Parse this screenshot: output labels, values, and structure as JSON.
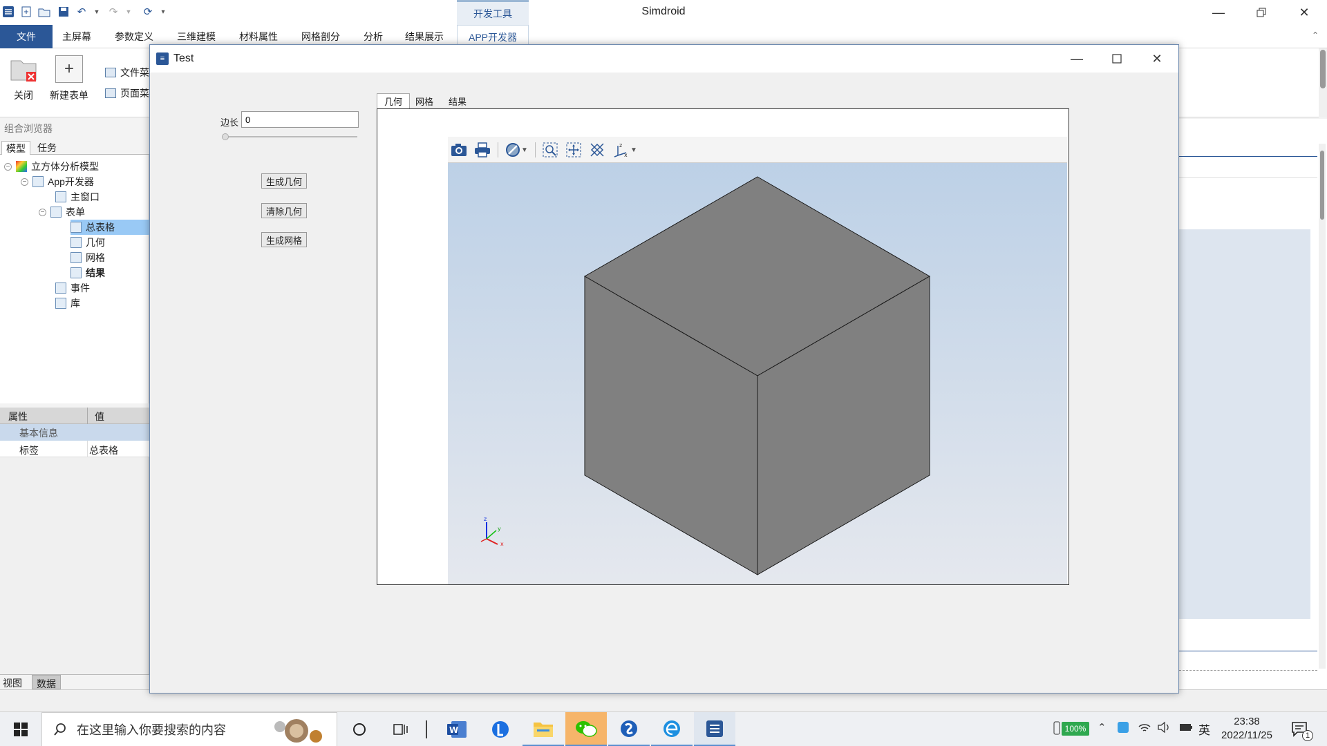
{
  "window": {
    "title": "Simdroid",
    "devtools_tab": "开发工具"
  },
  "ribbon": {
    "file_tab": "文件",
    "tabs": [
      "主屏幕",
      "参数定义",
      "三维建模",
      "材料属性",
      "网格剖分",
      "分析",
      "结果展示",
      "APP开发器"
    ],
    "close_label": "关闭",
    "new_form_label": "新建表单",
    "file_menu_label": "文件菜",
    "page_menu_label": "页面菜"
  },
  "browser": {
    "title": "组合浏览器",
    "tabs": [
      "模型",
      "任务"
    ],
    "tree": {
      "root": "立方体分析模型",
      "app_dev": "App开发器",
      "main_window": "主窗口",
      "forms": "表单",
      "form_items": [
        "总表格",
        "几何",
        "网格",
        "结果"
      ],
      "events": "事件",
      "library": "库"
    }
  },
  "properties": {
    "col_property": "属性",
    "col_value": "值",
    "section": "基本信息",
    "row_label": "标签",
    "row_value": "总表格"
  },
  "bottom_tabs": [
    "视图",
    "数据"
  ],
  "dialog": {
    "title": "Test",
    "edge_label": "边长",
    "edge_value": "0",
    "slider_fraction": 0,
    "buttons": {
      "generate_geometry": "生成几何",
      "clear_geometry": "清除几何",
      "generate_mesh": "生成网格"
    },
    "tabs": [
      "几何",
      "网格",
      "结果"
    ]
  },
  "taskbar": {
    "search_placeholder": "在这里输入你要搜索的内容",
    "battery": "100%",
    "ime": "英",
    "time": "23:38",
    "date": "2022/11/25",
    "notifications": "1"
  },
  "colors": {
    "accent": "#2b5797",
    "cube_face": "#808080",
    "viewer_top": "#bacfe6",
    "viewer_bottom": "#e5e8ee"
  }
}
